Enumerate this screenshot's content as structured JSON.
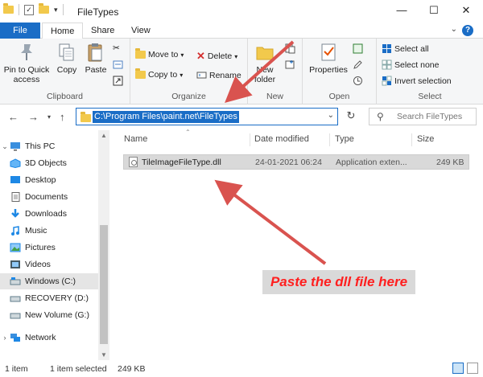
{
  "window": {
    "title": "FileTypes",
    "controls": {
      "minimize": "—",
      "maximize": "☐",
      "close": "✕"
    }
  },
  "ribbon_tabs": [
    "File",
    "Home",
    "Share",
    "View"
  ],
  "ribbon": {
    "clipboard": {
      "label": "Clipboard",
      "pin": "Pin to Quick access",
      "copy": "Copy",
      "paste": "Paste"
    },
    "organize": {
      "label": "Organize",
      "move_to": "Move to",
      "copy_to": "Copy to",
      "delete": "Delete",
      "rename": "Rename"
    },
    "new": {
      "label": "New",
      "new_folder": "New folder"
    },
    "open": {
      "label": "Open",
      "properties": "Properties"
    },
    "select": {
      "label": "Select",
      "select_all": "Select all",
      "select_none": "Select none",
      "invert_selection": "Invert selection"
    }
  },
  "address_bar": {
    "path": "C:\\Program Files\\paint.net\\FileTypes",
    "search_placeholder": "Search FileTypes"
  },
  "nav_pane": {
    "items": [
      {
        "label": "This PC",
        "icon": "computer-icon"
      },
      {
        "label": "3D Objects",
        "icon": "3d-objects-icon"
      },
      {
        "label": "Desktop",
        "icon": "desktop-icon"
      },
      {
        "label": "Documents",
        "icon": "documents-icon"
      },
      {
        "label": "Downloads",
        "icon": "downloads-icon"
      },
      {
        "label": "Music",
        "icon": "music-icon"
      },
      {
        "label": "Pictures",
        "icon": "pictures-icon"
      },
      {
        "label": "Videos",
        "icon": "videos-icon"
      },
      {
        "label": "Windows (C:)",
        "icon": "drive-icon"
      },
      {
        "label": "RECOVERY (D:)",
        "icon": "drive-icon"
      },
      {
        "label": "New Volume (G:)",
        "icon": "drive-icon"
      },
      {
        "label": "Network",
        "icon": "network-icon"
      }
    ]
  },
  "file_list": {
    "columns": [
      "Name",
      "Date modified",
      "Type",
      "Size"
    ],
    "rows": [
      {
        "name": "TileImageFileType.dll",
        "date": "24-01-2021 06:24",
        "type": "Application exten...",
        "size": "249 KB"
      }
    ]
  },
  "annotation": "Paste the dll file here",
  "status_bar": {
    "count": "1 item",
    "selected": "1 item selected",
    "size": "249 KB"
  },
  "colors": {
    "accent": "#1a6dc6",
    "annotation_text": "#ff1f1f",
    "arrow": "#d9534f"
  }
}
